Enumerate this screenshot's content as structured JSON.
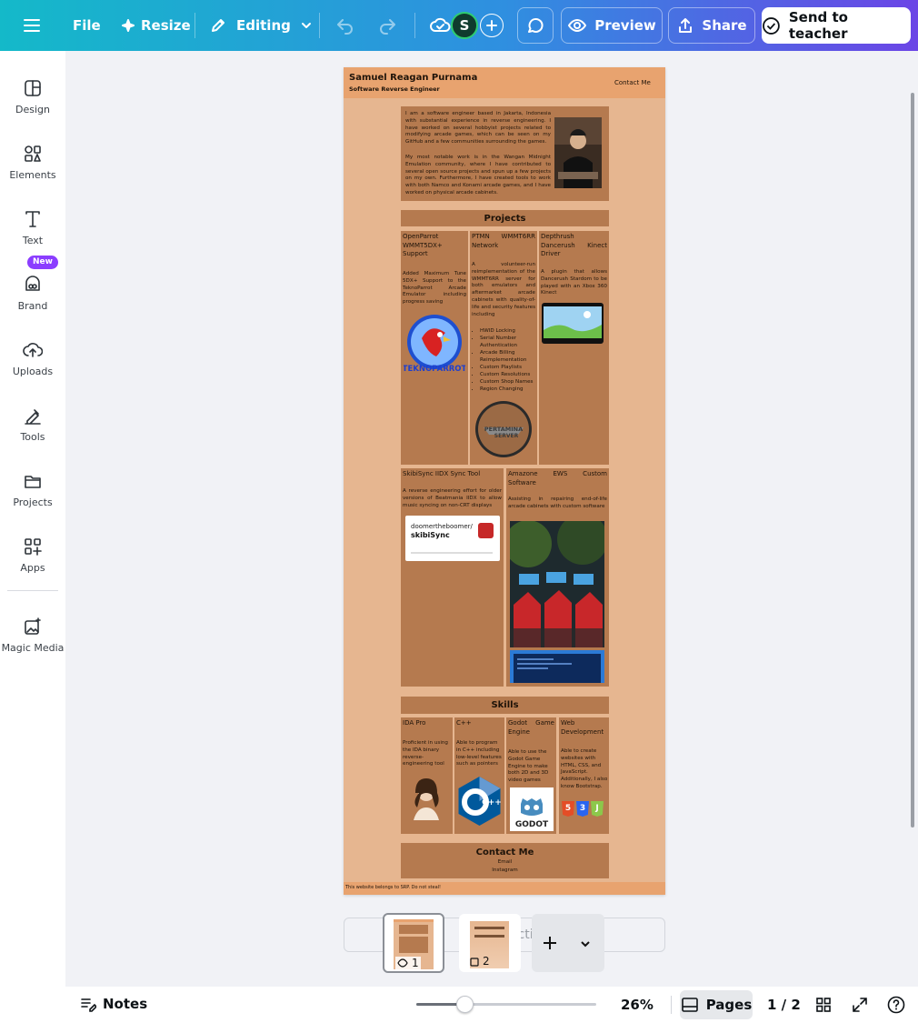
{
  "topbar": {
    "file": "File",
    "resize": "Resize",
    "editing": "Editing",
    "avatar": "S",
    "preview": "Preview",
    "share": "Share",
    "send": "Send to teacher"
  },
  "sidebar": {
    "items": [
      {
        "label": "Design",
        "icon": "design-icon"
      },
      {
        "label": "Elements",
        "icon": "elements-icon"
      },
      {
        "label": "Text",
        "icon": "text-icon"
      },
      {
        "label": "Brand",
        "icon": "brand-icon"
      },
      {
        "label": "Uploads",
        "icon": "uploads-icon"
      },
      {
        "label": "Tools",
        "icon": "tools-icon"
      },
      {
        "label": "Projects",
        "icon": "projects-icon"
      },
      {
        "label": "Apps",
        "icon": "apps-icon"
      },
      {
        "label": "Magic Media",
        "icon": "magic-media-icon"
      }
    ],
    "new_badge": "New"
  },
  "design": {
    "name": "Samuel Reagan Purnama",
    "role": "Software Reverse Engineer",
    "contact_link": "Contact Me",
    "about_1": "I am a software engineer based in Jakarta, Indonesia with substantial experience in reverse engineering. I have worked on several hobbyist projects related to modifying arcade games, which can be seen on my GitHub and a few communities surrounding the games.",
    "about_2": "My most notable work is in the Wangan Midnight Emulation community, where I have contributed to several open source projects and spun up a few projects on my own. Furthermore, I have created tools to work with both Namco and Konami arcade games, and I have worked on physical arcade cabinets.",
    "projects_heading": "Projects",
    "projects": [
      {
        "title": "OpenParrot WMMT5DX+ Support",
        "desc": "Added Maximum Tune 5DX+ Support to the TeknoParrot Arcade Emulator including progress saving",
        "logo_text": "TEKNOPARROT"
      },
      {
        "title": "PTMN WMMT6RR Network",
        "desc": "A volunteer-run reimplementation of the WMMT6RR server for both emulators and aftermarket arcade cabinets with quality-of-life and security features including",
        "bullets": [
          "HWID Locking",
          "Serial Number Authentication",
          "Arcade Billing Reimplementation",
          "Custom Playlists",
          "Custom Resolutions",
          "Custom Shop Names",
          "Region Changing"
        ],
        "logo_text_1": "PERTAMINA",
        "logo_text_2": "SERVER"
      },
      {
        "title": "Depthrush Dancerush Kinect Driver",
        "desc": "A plugin that allows Dancerush Stardom to be played with an Xbox 360 Kinect"
      },
      {
        "title": "SkibiSync IIDX Sync Tool",
        "desc": "A reverse engineering effort for older versions of Beatmania IIDX to allow music syncing on non-CRT displays",
        "repo_owner": "doomertheboomer/",
        "repo_name": "skibiSync"
      },
      {
        "title": "Amazone EWS Custom Software",
        "desc": "Assisting in repairing end-of-life arcade cabinets with custom software"
      }
    ],
    "skills_heading": "Skills",
    "skills": [
      {
        "title": "IDA Pro",
        "desc": "Proficient in using the IDA binary reverse-engineering tool"
      },
      {
        "title": "C++",
        "desc": "Able to program in C++ including low-level features such as pointers",
        "logo_text": "C++"
      },
      {
        "title": "Godot Game Engine",
        "desc": "Able to use the Godot Game Engine to make both 2D and 3D video games",
        "logo_text": "GODOT"
      },
      {
        "title": "Web Development",
        "desc": "Able to create websites with HTML, CSS, and JavaScript. Additionally, I also know Bootstrap.",
        "badges": [
          "5",
          "3",
          "J"
        ]
      }
    ],
    "contact_heading": "Contact Me",
    "contact_email": "Email",
    "contact_instagram": "Instagram",
    "footer": "This website belongs to SRP. Do not steal!"
  },
  "pages_strip": {
    "add_section": "+ Add section",
    "page1": "1",
    "page2": "2"
  },
  "bottombar": {
    "notes": "Notes",
    "zoom_pct": 26,
    "zoom": "26%",
    "pages": "Pages",
    "page_count": "1 / 2"
  },
  "colors": {
    "header": "#e8a36f",
    "page_bg": "#e6b690",
    "box": "#b57a4f",
    "accent": "#8b3dff"
  }
}
